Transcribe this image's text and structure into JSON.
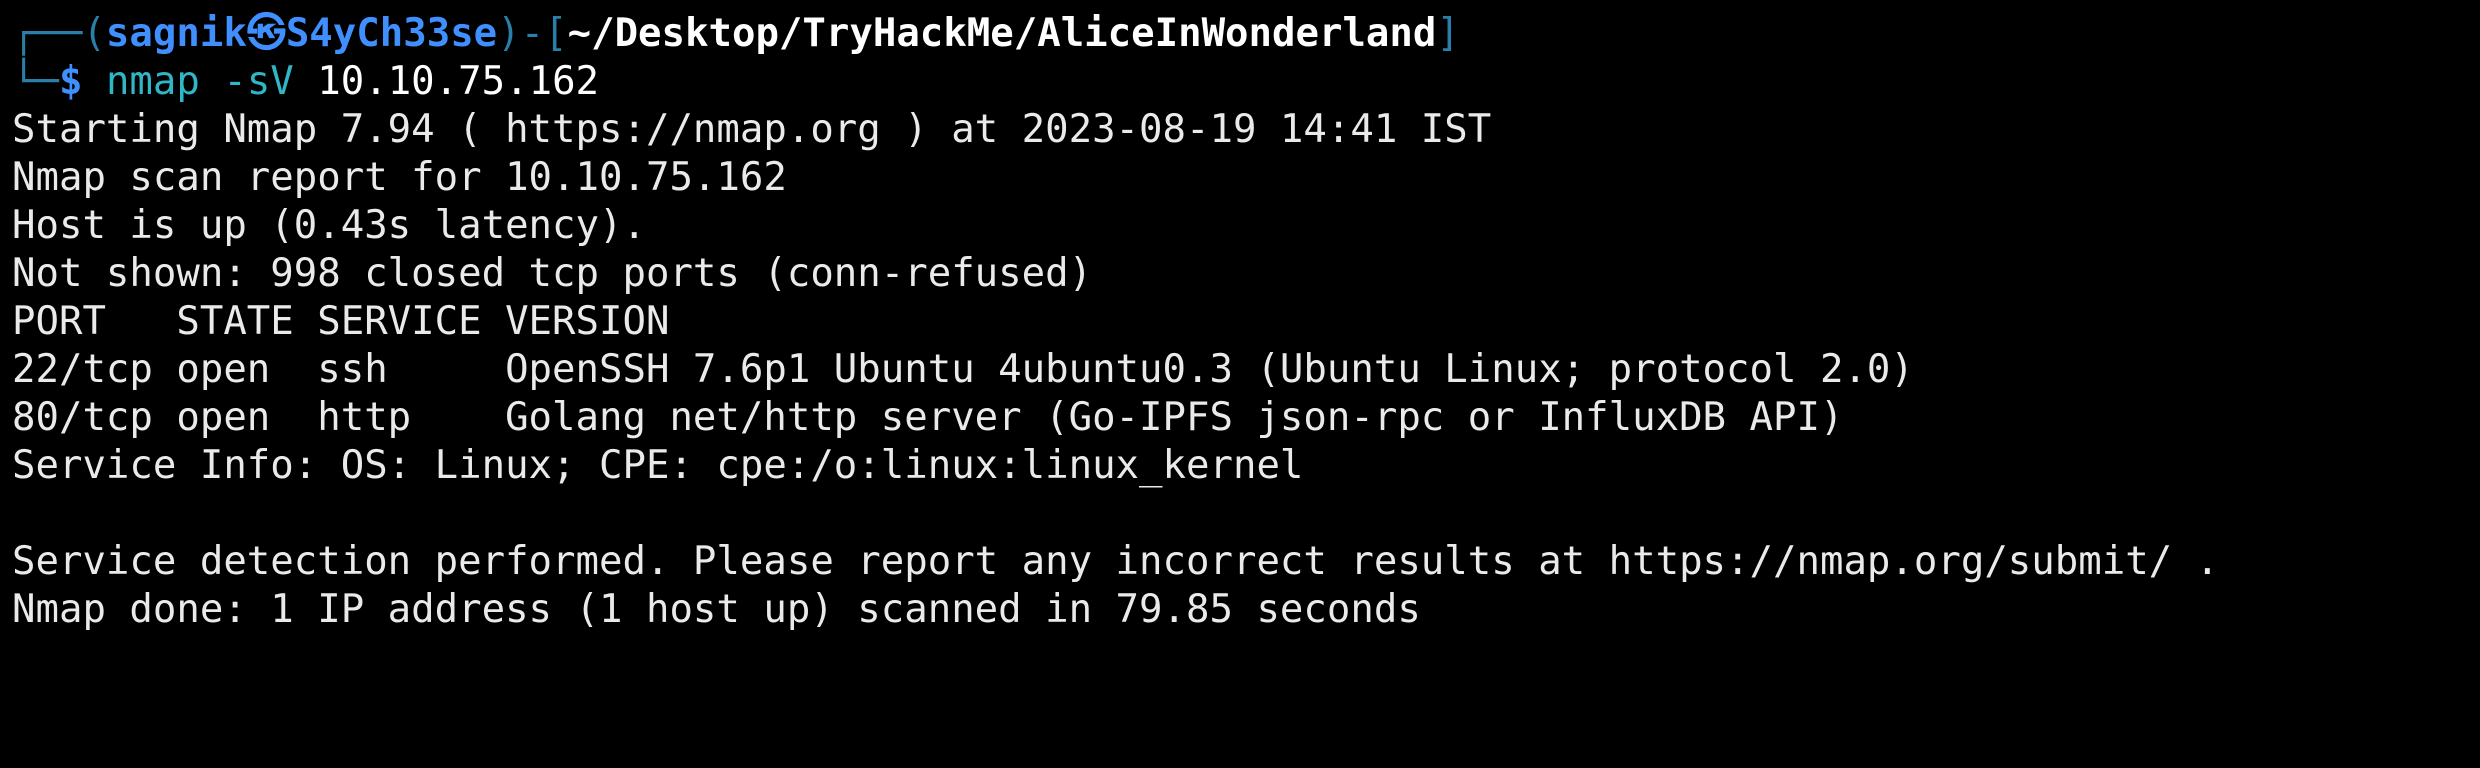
{
  "prompt": {
    "frame_left": "┌──(",
    "user": "sagnik",
    "skull": "㉿",
    "host": "S4yCh33se",
    "frame_mid": ")-[",
    "path": "~/Desktop/TryHackMe/AliceInWonderland",
    "frame_right": "]",
    "frame_bottom": "└─",
    "dollar": "$",
    "command": "nmap -sV",
    "target": "10.10.75.162"
  },
  "output": {
    "lines": [
      "Starting Nmap 7.94 ( https://nmap.org ) at 2023-08-19 14:41 IST",
      "Nmap scan report for 10.10.75.162",
      "Host is up (0.43s latency).",
      "Not shown: 998 closed tcp ports (conn-refused)",
      "PORT   STATE SERVICE VERSION",
      "22/tcp open  ssh     OpenSSH 7.6p1 Ubuntu 4ubuntu0.3 (Ubuntu Linux; protocol 2.0)",
      "80/tcp open  http    Golang net/http server (Go-IPFS json-rpc or InfluxDB API)",
      "Service Info: OS: Linux; CPE: cpe:/o:linux:linux_kernel",
      "Service detection performed. Please report any incorrect results at https://nmap.org/submit/ .",
      "Nmap done: 1 IP address (1 host up) scanned in 79.85 seconds"
    ]
  },
  "colors": {
    "background": "#000000",
    "text": "#eaeaea",
    "prompt_frame": "#2a7fa8",
    "prompt_user": "#3f8fff",
    "command": "#2fb6c7"
  }
}
